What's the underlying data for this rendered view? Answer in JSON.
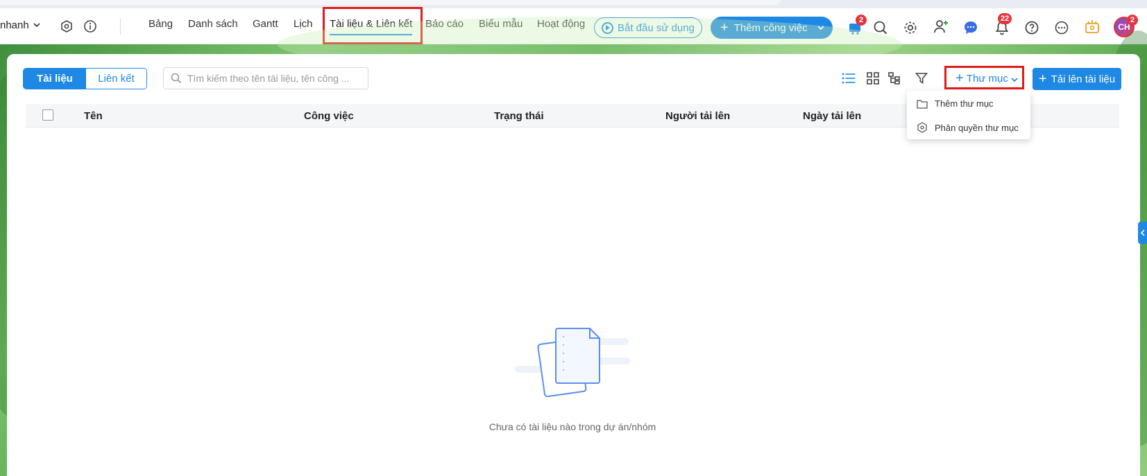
{
  "header": {
    "project_name": "nhanh",
    "nav": [
      "Bảng",
      "Danh sách",
      "Gantt",
      "Lịch",
      "Tài liệu & Liên kết",
      "Báo cáo",
      "Biểu mẫu",
      "Hoạt động"
    ],
    "active_nav": "Tài liệu & Liên kết",
    "start_label": "Bắt đầu sử dụng",
    "add_task_label": "Thêm công việc",
    "cart_badge": "2",
    "notif_badge": "22",
    "avatar_initials": "CH",
    "avatar_badge": "2"
  },
  "toolbar": {
    "tab_docs": "Tài liệu",
    "tab_links": "Liên kết",
    "search_placeholder": "Tìm kiếm theo tên tài liệu, tên công ...",
    "folder_label": "Thư mục",
    "upload_label": "Tải lên tài liệu"
  },
  "dropdown": {
    "add_folder": "Thêm thư mục",
    "folder_permission": "Phân quyền thư mục"
  },
  "table": {
    "columns": [
      "Tên",
      "Công việc",
      "Trạng thái",
      "Người tải lên",
      "Ngày tải lên"
    ]
  },
  "empty_state": {
    "message": "Chưa có tài liệu nào trong dự án/nhóm"
  },
  "colors": {
    "primary": "#1e88e5",
    "highlight": "#e01b1b",
    "badge": "#e5353a"
  }
}
